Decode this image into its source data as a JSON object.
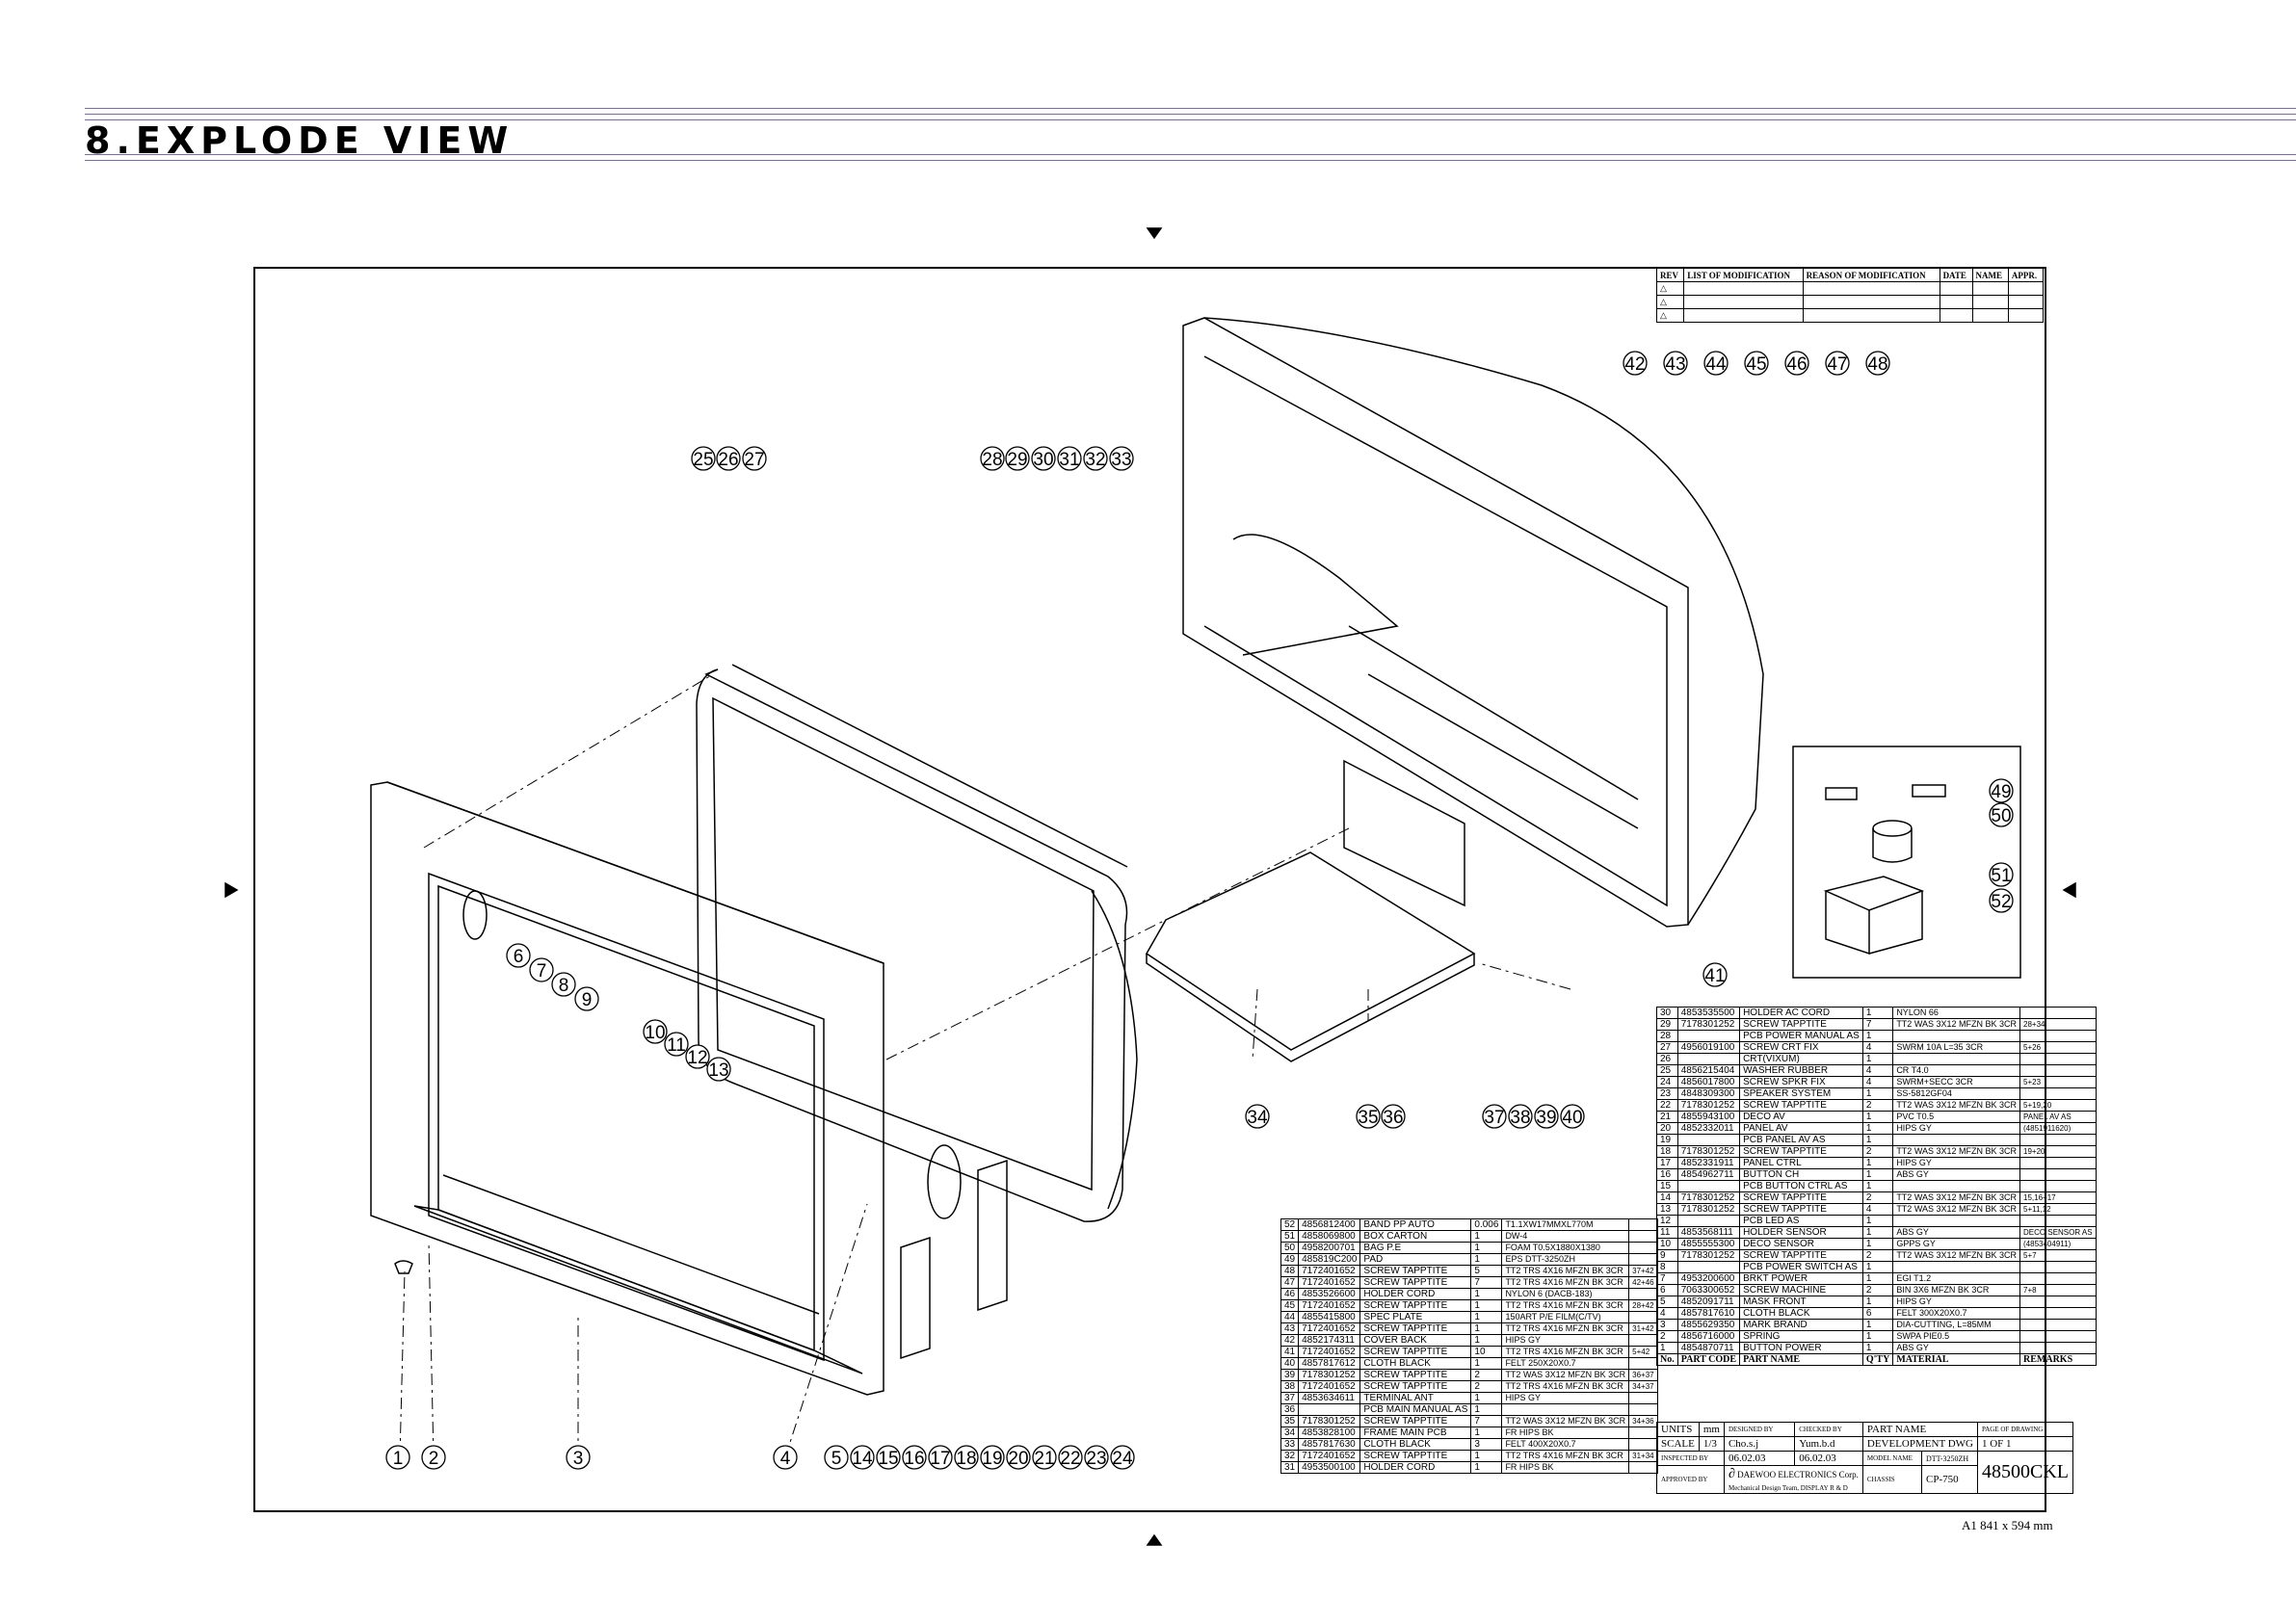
{
  "title": "8.EXPLODE VIEW",
  "callouts": [
    "1",
    "2",
    "3",
    "4",
    "5",
    "6",
    "7",
    "8",
    "9",
    "10",
    "11",
    "12",
    "13",
    "14",
    "15",
    "16",
    "17",
    "18",
    "19",
    "20",
    "21",
    "22",
    "23",
    "24",
    "25",
    "26",
    "27",
    "28",
    "29",
    "30",
    "31",
    "32",
    "33",
    "34",
    "35",
    "36",
    "37",
    "38",
    "39",
    "40",
    "41",
    "42",
    "43",
    "44",
    "45",
    "46",
    "47",
    "48",
    "49",
    "50",
    "51",
    "52"
  ],
  "revision": {
    "headers": [
      "REV",
      "LIST OF MODIFICATION",
      "REASON OF MODIFICATION",
      "DATE",
      "NAME",
      "APPR."
    ],
    "rows": [
      [
        "△",
        "",
        "",
        "",
        "",
        ""
      ],
      [
        "△",
        "",
        "",
        "",
        "",
        ""
      ],
      [
        "△",
        "",
        "",
        "",
        "",
        ""
      ]
    ]
  },
  "parts_left": [
    [
      "52",
      "4856812400",
      "BAND PP AUTO",
      "0.006",
      "T1.1XW17MMXL770M",
      ""
    ],
    [
      "51",
      "4858069800",
      "BOX CARTON",
      "1",
      "DW-4",
      ""
    ],
    [
      "50",
      "4958200701",
      "BAG P.E",
      "1",
      "FOAM T0.5X1880X1380",
      ""
    ],
    [
      "49",
      "485819C200",
      "PAD",
      "1",
      "EPS DTT-3250ZH",
      ""
    ],
    [
      "48",
      "7172401652",
      "SCREW TAPPTITE",
      "5",
      "TT2 TRS 4X16 MFZN BK 3CR",
      "37+42"
    ],
    [
      "47",
      "7172401652",
      "SCREW TAPPTITE",
      "7",
      "TT2 TRS 4X16 MFZN BK 3CR",
      "42+46"
    ],
    [
      "46",
      "4853526600",
      "HOLDER CORD",
      "1",
      "NYLON 6 (DACB-183)",
      ""
    ],
    [
      "45",
      "7172401652",
      "SCREW TAPPTITE",
      "1",
      "TT2 TRS 4X16 MFZN BK 3CR",
      "28+42"
    ],
    [
      "44",
      "4855415800",
      "SPEC PLATE",
      "1",
      "150ART P/E FILM(C/TV)",
      ""
    ],
    [
      "43",
      "7172401652",
      "SCREW TAPPTITE",
      "1",
      "TT2 TRS 4X16 MFZN BK 3CR",
      "31+42"
    ],
    [
      "42",
      "4852174311",
      "COVER BACK",
      "1",
      "HIPS GY",
      ""
    ],
    [
      "41",
      "7172401652",
      "SCREW TAPPTITE",
      "10",
      "TT2 TRS 4X16 MFZN BK 3CR",
      "5+42"
    ],
    [
      "40",
      "4857817612",
      "CLOTH BLACK",
      "1",
      "FELT 250X20X0.7",
      ""
    ],
    [
      "39",
      "7178301252",
      "SCREW TAPPTITE",
      "2",
      "TT2 WAS 3X12 MFZN BK 3CR",
      "36+37"
    ],
    [
      "38",
      "7172401652",
      "SCREW TAPPTITE",
      "2",
      "TT2 TRS 4X16 MFZN BK 3CR",
      "34+37"
    ],
    [
      "37",
      "4853634611",
      "TERMINAL ANT",
      "1",
      "HIPS GY",
      ""
    ],
    [
      "36",
      "",
      "PCB MAIN MANUAL AS",
      "1",
      "",
      ""
    ],
    [
      "35",
      "7178301252",
      "SCREW TAPPTITE",
      "7",
      "TT2 WAS 3X12 MFZN BK 3CR",
      "34+36"
    ],
    [
      "34",
      "4853828100",
      "FRAME MAIN PCB",
      "1",
      "FR HIPS BK",
      ""
    ],
    [
      "33",
      "4857817630",
      "CLOTH BLACK",
      "3",
      "FELT 400X20X0.7",
      ""
    ],
    [
      "32",
      "7172401652",
      "SCREW TAPPTITE",
      "1",
      "TT2 TRS 4X16 MFZN BK 3CR",
      "31+34"
    ],
    [
      "31",
      "4953500100",
      "HOLDER CORD",
      "1",
      "FR HIPS BK",
      ""
    ]
  ],
  "parts_right": [
    [
      "30",
      "4853535500",
      "HOLDER AC CORD",
      "1",
      "NYLON 66",
      ""
    ],
    [
      "29",
      "7178301252",
      "SCREW TAPPTITE",
      "7",
      "TT2 WAS 3X12 MFZN BK 3CR",
      "28+34"
    ],
    [
      "28",
      "",
      "PCB POWER MANUAL AS",
      "1",
      "",
      ""
    ],
    [
      "27",
      "4956019100",
      "SCREW CRT FIX",
      "4",
      "SWRM 10A L=35 3CR",
      "5+26"
    ],
    [
      "26",
      "",
      "CRT(VIXUM)",
      "1",
      "",
      ""
    ],
    [
      "25",
      "4856215404",
      "WASHER RUBBER",
      "4",
      "CR T4.0",
      ""
    ],
    [
      "24",
      "4856017800",
      "SCREW SPKR FIX",
      "4",
      "SWRM+SECC 3CR",
      "5+23"
    ],
    [
      "23",
      "4848309300",
      "SPEAKER SYSTEM",
      "1",
      "SS-5812GF04",
      ""
    ],
    [
      "22",
      "7178301252",
      "SCREW TAPPTITE",
      "2",
      "TT2 WAS 3X12 MFZN BK 3CR",
      "5+19,20"
    ],
    [
      "21",
      "4855943100",
      "DECO AV",
      "1",
      "PVC T0.5",
      "PANEL AV AS"
    ],
    [
      "20",
      "4852332011",
      "PANEL AV",
      "1",
      "HIPS GY",
      "(4851911620)"
    ],
    [
      "19",
      "",
      "PCB PANEL AV AS",
      "1",
      "",
      ""
    ],
    [
      "18",
      "7178301252",
      "SCREW TAPPTITE",
      "2",
      "TT2 WAS 3X12 MFZN BK 3CR",
      "19+20"
    ],
    [
      "17",
      "4852331911",
      "PANEL CTRL",
      "1",
      "HIPS GY",
      ""
    ],
    [
      "16",
      "4854962711",
      "BUTTON CH",
      "1",
      "ABS GY",
      ""
    ],
    [
      "15",
      "",
      "PCB BUTTON CTRL AS",
      "1",
      "",
      ""
    ],
    [
      "14",
      "7178301252",
      "SCREW TAPPTITE",
      "2",
      "TT2 WAS 3X12 MFZN BK 3CR",
      "15,16+17"
    ],
    [
      "13",
      "7178301252",
      "SCREW TAPPTITE",
      "4",
      "TT2 WAS 3X12 MFZN BK 3CR",
      "5+11,12"
    ],
    [
      "12",
      "",
      "PCB LED AS",
      "1",
      "",
      ""
    ],
    [
      "11",
      "4853568111",
      "HOLDER SENSOR",
      "1",
      "ABS GY",
      "DECO SENSOR AS"
    ],
    [
      "10",
      "4855555300",
      "DECO SENSOR",
      "1",
      "GPPS GY",
      "(4853404911)"
    ],
    [
      "9",
      "7178301252",
      "SCREW TAPPTITE",
      "2",
      "TT2 WAS 3X12 MFZN BK 3CR",
      "5+7"
    ],
    [
      "8",
      "",
      "PCB POWER SWITCH AS",
      "1",
      "",
      ""
    ],
    [
      "7",
      "4953200600",
      "BRKT POWER",
      "1",
      "EGI T1.2",
      ""
    ],
    [
      "6",
      "7063300652",
      "SCREW MACHINE",
      "2",
      "BIN 3X6 MFZN BK 3CR",
      "7+8"
    ],
    [
      "5",
      "4852091711",
      "MASK FRONT",
      "1",
      "HIPS GY",
      ""
    ],
    [
      "4",
      "4857817610",
      "CLOTH BLACK",
      "6",
      "FELT 300X20X0.7",
      ""
    ],
    [
      "3",
      "4855629350",
      "MARK BRAND",
      "1",
      "DIA-CUTTING, L=85MM",
      ""
    ],
    [
      "2",
      "4856716000",
      "SPRING",
      "1",
      "SWPA PIE0.5",
      ""
    ],
    [
      "1",
      "4854870711",
      "BUTTON POWER",
      "1",
      "ABS GY",
      ""
    ]
  ],
  "parts_header": [
    "No.",
    "PART CODE",
    "PART NAME",
    "Q'TY",
    "MATERIAL",
    "REMARKS"
  ],
  "titleblock": {
    "units_label": "UNITS",
    "units": "mm",
    "designed_by": "DESIGNED BY",
    "checked_by": "CHECKED BY",
    "inspected_by": "INSPECTED BY",
    "approved_by": "APPROVED BY",
    "designer": "Cho.s.j",
    "checker": "Yum.b.d",
    "date1": "06.02.03",
    "date2": "06.02.03",
    "scale_label": "SCALE",
    "scale": "1/3",
    "part_name_label": "PART NAME",
    "page_label": "PAGE OF DRAWING",
    "drawing_type": "DEVELOPMENT DWG",
    "page": "1 OF 1",
    "company": "DAEWOO ELECTRONICS Corp.",
    "department": "Mechanical Design Team, DISPLAY R & D",
    "model_label": "MODEL NAME",
    "model": "DTT-3250ZH",
    "chassis_label": "CHASSIS",
    "chassis": "CP-750",
    "dn_label": "D / N",
    "drawing_no": "48500CKL",
    "sheet": "A1 841 x 594 mm"
  },
  "colors": {
    "rule": "#7a6aa8",
    "line": "#000000"
  }
}
